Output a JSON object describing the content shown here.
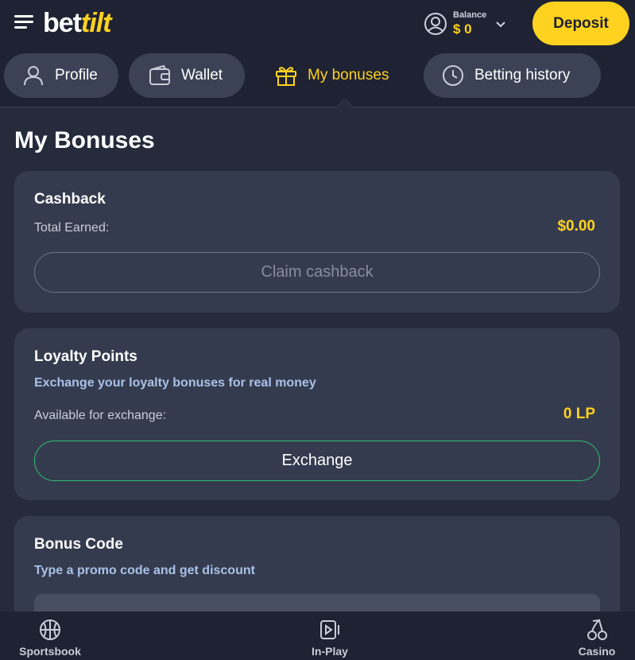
{
  "header": {
    "logo": {
      "part1": "bet",
      "part2": "tilt"
    },
    "balance": {
      "label": "Balance",
      "value": "$ 0"
    },
    "deposit_label": "Deposit"
  },
  "tabs": [
    {
      "label": "Profile",
      "icon": "user-icon",
      "active": false
    },
    {
      "label": "Wallet",
      "icon": "wallet-icon",
      "active": false
    },
    {
      "label": "My bonuses",
      "icon": "gift-icon",
      "active": true
    },
    {
      "label": "Betting history",
      "icon": "clock-icon",
      "active": false
    }
  ],
  "page": {
    "title": "My Bonuses"
  },
  "cashback": {
    "title": "Cashback",
    "total_label": "Total Earned:",
    "total_value": "$0.00",
    "button_label": "Claim cashback"
  },
  "loyalty": {
    "title": "Loyalty Points",
    "subtitle": "Exchange your loyalty bonuses for real money",
    "available_label": "Available for exchange:",
    "available_value": "0 LP",
    "button_label": "Exchange"
  },
  "bonus_code": {
    "title": "Bonus Code",
    "subtitle": "Type a promo code and get discount"
  },
  "bottom_nav": [
    {
      "label": "Sportsbook",
      "icon": "basketball-icon"
    },
    {
      "label": "In-Play",
      "icon": "play-icon"
    },
    {
      "label": "Casino",
      "icon": "cherries-icon"
    }
  ],
  "colors": {
    "accent": "#ffd21f",
    "background": "#262b3c",
    "header": "#1e2232",
    "card": "#353b4e",
    "exchange_border": "#2fbf71"
  }
}
